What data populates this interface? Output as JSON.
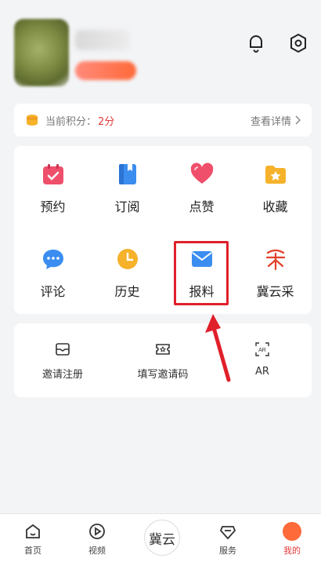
{
  "points": {
    "label": "当前积分：",
    "value": "2分",
    "detail": "查看详情"
  },
  "grid": [
    {
      "label": "预约",
      "icon": "calendar-icon",
      "color": "#ef4f6a"
    },
    {
      "label": "订阅",
      "icon": "bookmark-book-icon",
      "color": "#3b8df0"
    },
    {
      "label": "点赞",
      "icon": "heart-icon",
      "color": "#ef4f6a"
    },
    {
      "label": "收藏",
      "icon": "star-folder-icon",
      "color": "#f5b22a"
    },
    {
      "label": "评论",
      "icon": "chat-bubble-icon",
      "color": "#3b8df0"
    },
    {
      "label": "历史",
      "icon": "clock-icon",
      "color": "#f5b22a"
    },
    {
      "label": "报料",
      "icon": "envelope-icon",
      "color": "#3b8df0"
    },
    {
      "label": "冀云采",
      "icon": "jiyuncai-logo-icon",
      "color": "#e2402a"
    }
  ],
  "invite": [
    {
      "label": "邀请注册",
      "icon": "envelope-outline-icon"
    },
    {
      "label": "填写邀请码",
      "icon": "ticket-icon"
    },
    {
      "label": "AR",
      "icon": "ar-scan-icon"
    }
  ],
  "nav": [
    {
      "label": "首页",
      "icon": "home-icon"
    },
    {
      "label": "视频",
      "icon": "play-icon"
    },
    {
      "label": "冀云",
      "icon": "jiyun-logo"
    },
    {
      "label": "服务",
      "icon": "service-icon"
    },
    {
      "label": "我的",
      "icon": "me-icon"
    }
  ],
  "colors": {
    "accent": "#e23b3b",
    "highlight": "#e0202a"
  }
}
